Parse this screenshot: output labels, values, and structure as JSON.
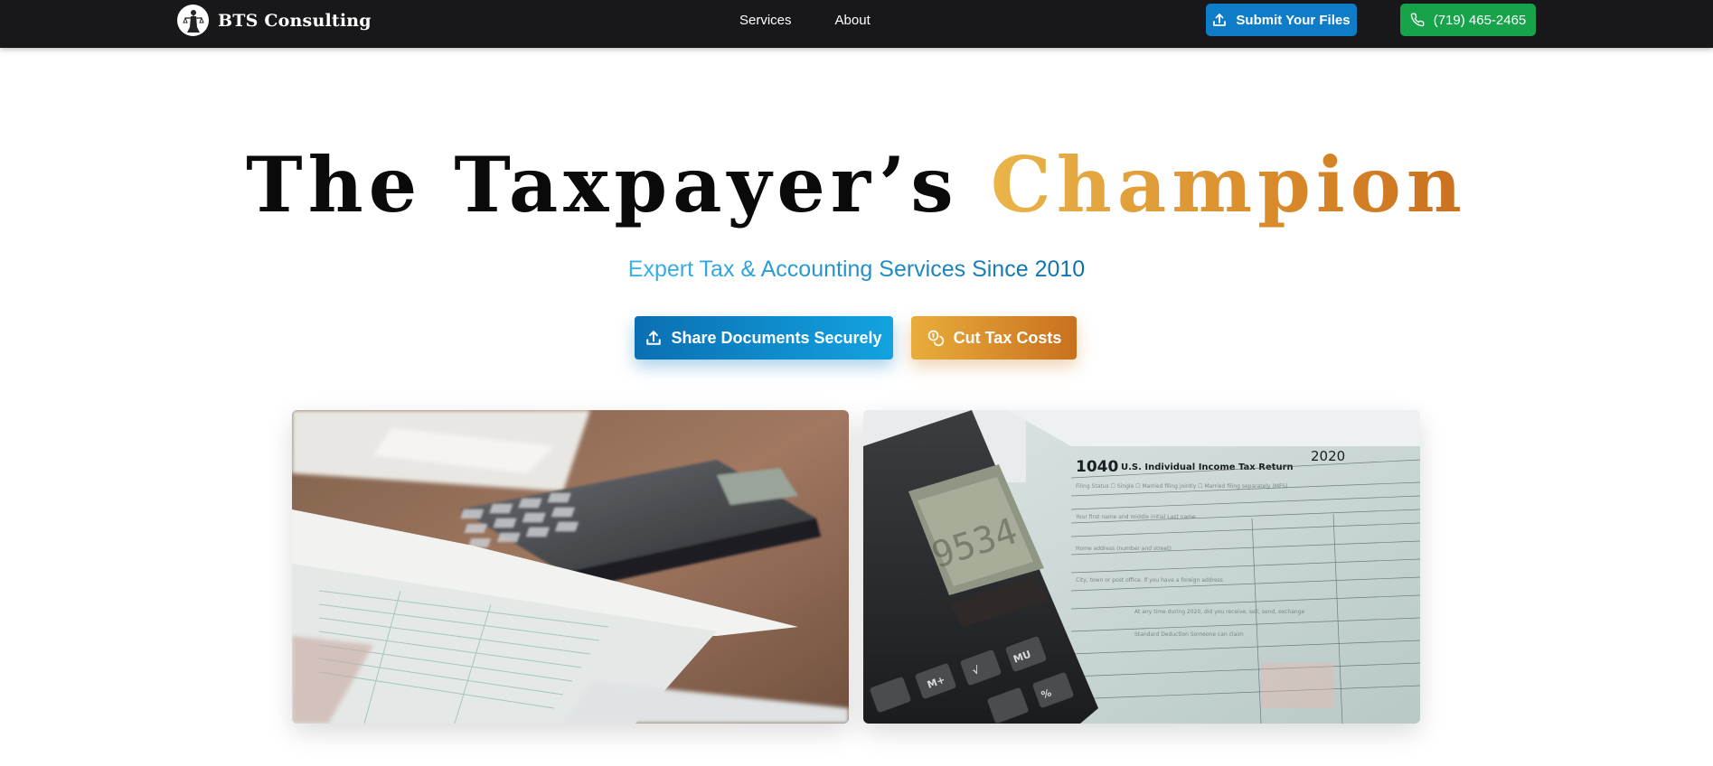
{
  "nav": {
    "brand_name": "BTS Consulting",
    "links": [
      {
        "label": "Services"
      },
      {
        "label": "About"
      }
    ],
    "submit_label": "Submit Your Files",
    "phone_label": "(719) 465-2465"
  },
  "hero": {
    "title_main": "The Taxpayer’s",
    "title_accent": "Champion",
    "subtitle": "Expert Tax & Accounting Services Since 2010",
    "cta_share_label": "Share Documents Securely",
    "cta_cut_label": "Cut Tax Costs"
  },
  "photos": {
    "left_icon": "calculator-and-papers-photo",
    "right_icon": "tax-form-1040-and-calculator-photo",
    "form_number": "1040",
    "form_title": "U.S. Individual Income Tax Return",
    "form_year": "2020"
  },
  "colors": {
    "nav_bg": "#18181b",
    "blue": "#0e7cc7",
    "green": "#16a34a",
    "gold": "#e0a33a"
  }
}
